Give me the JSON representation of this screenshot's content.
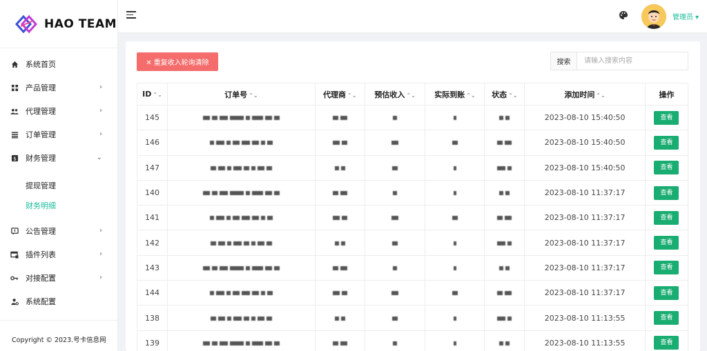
{
  "brand": {
    "name": "HAO TEAM"
  },
  "sidebar": {
    "items": [
      {
        "label": "系统首页",
        "icon": "home-icon",
        "has_arrow": false
      },
      {
        "label": "产品管理",
        "icon": "grid-icon",
        "has_arrow": true
      },
      {
        "label": "代理管理",
        "icon": "users-icon",
        "has_arrow": true
      },
      {
        "label": "订单管理",
        "icon": "list-icon",
        "has_arrow": true
      },
      {
        "label": "财务管理",
        "icon": "finance-icon",
        "has_arrow": true,
        "expanded": true
      }
    ],
    "sub_items": [
      {
        "label": "提现管理",
        "active": false
      },
      {
        "label": "财务明细",
        "active": true
      }
    ],
    "items_after": [
      {
        "label": "公告管理",
        "icon": "announce-icon"
      },
      {
        "label": "插件列表",
        "icon": "plugin-icon"
      },
      {
        "label": "对接配置",
        "icon": "key-icon"
      },
      {
        "label": "系统配置",
        "icon": "user-gear-icon"
      }
    ],
    "footer": "Copyright © 2023.号卡信息网"
  },
  "header": {
    "admin_label": "管理员 ▾"
  },
  "toolbar": {
    "clear_button": "✕ 重复收入轮询清除",
    "search_label": "搜索",
    "search_placeholder": "请输入搜索内容"
  },
  "table": {
    "columns": [
      "ID",
      "订单号",
      "代理商",
      "预估收入",
      "实际到账",
      "状态",
      "添加时间",
      "操作"
    ],
    "rows": [
      {
        "id": "145",
        "time": "2023-08-10 15:40:50",
        "action": "查看"
      },
      {
        "id": "146",
        "time": "2023-08-10 15:40:50",
        "action": "查看"
      },
      {
        "id": "147",
        "time": "2023-08-10 15:40:50",
        "action": "查看"
      },
      {
        "id": "140",
        "time": "2023-08-10 11:37:17",
        "action": "查看"
      },
      {
        "id": "141",
        "time": "2023-08-10 11:37:17",
        "action": "查看"
      },
      {
        "id": "142",
        "time": "2023-08-10 11:37:17",
        "action": "查看"
      },
      {
        "id": "143",
        "time": "2023-08-10 11:37:17",
        "action": "查看"
      },
      {
        "id": "144",
        "time": "2023-08-10 11:37:17",
        "action": "查看"
      },
      {
        "id": "138",
        "time": "2023-08-10 11:13:55",
        "action": "查看"
      },
      {
        "id": "139",
        "time": "2023-08-10 11:13:55",
        "action": "查看"
      }
    ]
  },
  "colors": {
    "accent": "#1abc9c",
    "danger": "#f56c6c",
    "success": "#1aad72"
  }
}
